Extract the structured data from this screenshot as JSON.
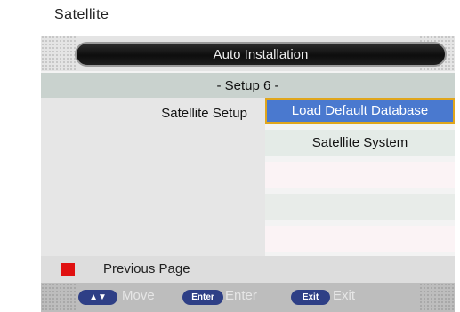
{
  "caption": "Satellite",
  "header": {
    "title": "Auto Installation"
  },
  "step_label": "- Setup 6 -",
  "setup": {
    "label": "Satellite Setup",
    "options": [
      {
        "label": "Load Default Database",
        "selected": true
      },
      {
        "label": "Satellite System",
        "selected": false
      },
      {
        "label": "",
        "selected": false
      },
      {
        "label": "",
        "selected": false
      },
      {
        "label": "",
        "selected": false
      }
    ]
  },
  "previous_page": {
    "label": "Previous Page",
    "color": "#e01010"
  },
  "help": {
    "move_key": "▲▼",
    "move_label": "Move",
    "enter_key": "Enter",
    "enter_label": "Enter",
    "exit_key": "Exit",
    "exit_label": "Exit"
  },
  "colors": {
    "selected_bg": "#4a79cf",
    "selected_border": "#e0a61c",
    "key_bg": "#2e3f86"
  }
}
